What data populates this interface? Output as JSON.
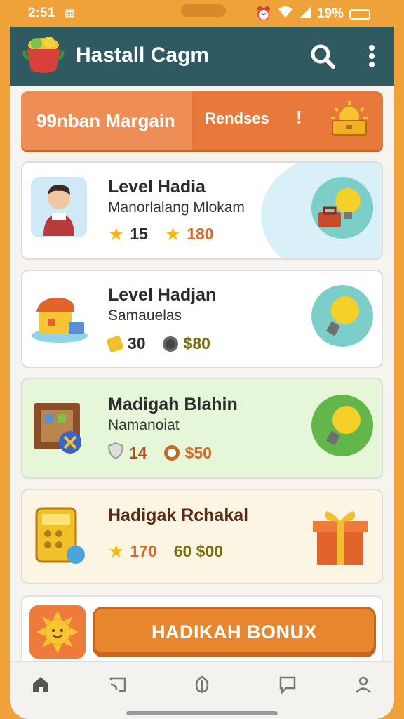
{
  "status_bar": {
    "time": "2:51",
    "battery": "19%"
  },
  "app_bar": {
    "title": "Hastall Cagm"
  },
  "tabs": [
    {
      "label": "99nban Margain"
    },
    {
      "label": "Rendses"
    }
  ],
  "tab_marker": "!",
  "cards": [
    {
      "title": "Level Hadia",
      "subtitle": "Manorlalang Mlokam",
      "stat1": "15",
      "stat2": "180",
      "bg": "#eaf6fb"
    },
    {
      "title": "Level Hadjan",
      "subtitle": "Samauelas",
      "stat1": "30",
      "stat2": "$80",
      "bg": "#ffffff"
    },
    {
      "title": "Madigah Blahin",
      "subtitle": "Namanoiat",
      "stat1": "14",
      "stat2": "$50",
      "bg": "#e6f6d8"
    },
    {
      "title": "Hadigak Rchakal",
      "subtitle": "",
      "stat1": "170",
      "stat2": "60 $00",
      "bg": "#fdf5e4"
    }
  ],
  "bonus": {
    "label": "HADIKAH BONUX"
  },
  "icons": {
    "status": [
      "vpn-icon",
      "alarm-icon",
      "wifi-icon",
      "signal-icon",
      "battery-icon"
    ],
    "app_bar": [
      "search-icon",
      "more-vert-icon"
    ],
    "nav": [
      "home-icon",
      "cast-icon",
      "leaf-icon",
      "chat-icon",
      "profile-icon"
    ]
  },
  "colors": {
    "frame": "#efa23a",
    "app_bar": "#2f5a62",
    "tab_bar": "#e9793a",
    "active_tab": "#ee8d55",
    "bonus_button": "#e8862e",
    "stat_orange": "#d9682a",
    "stat_olive": "#7a6a12"
  }
}
